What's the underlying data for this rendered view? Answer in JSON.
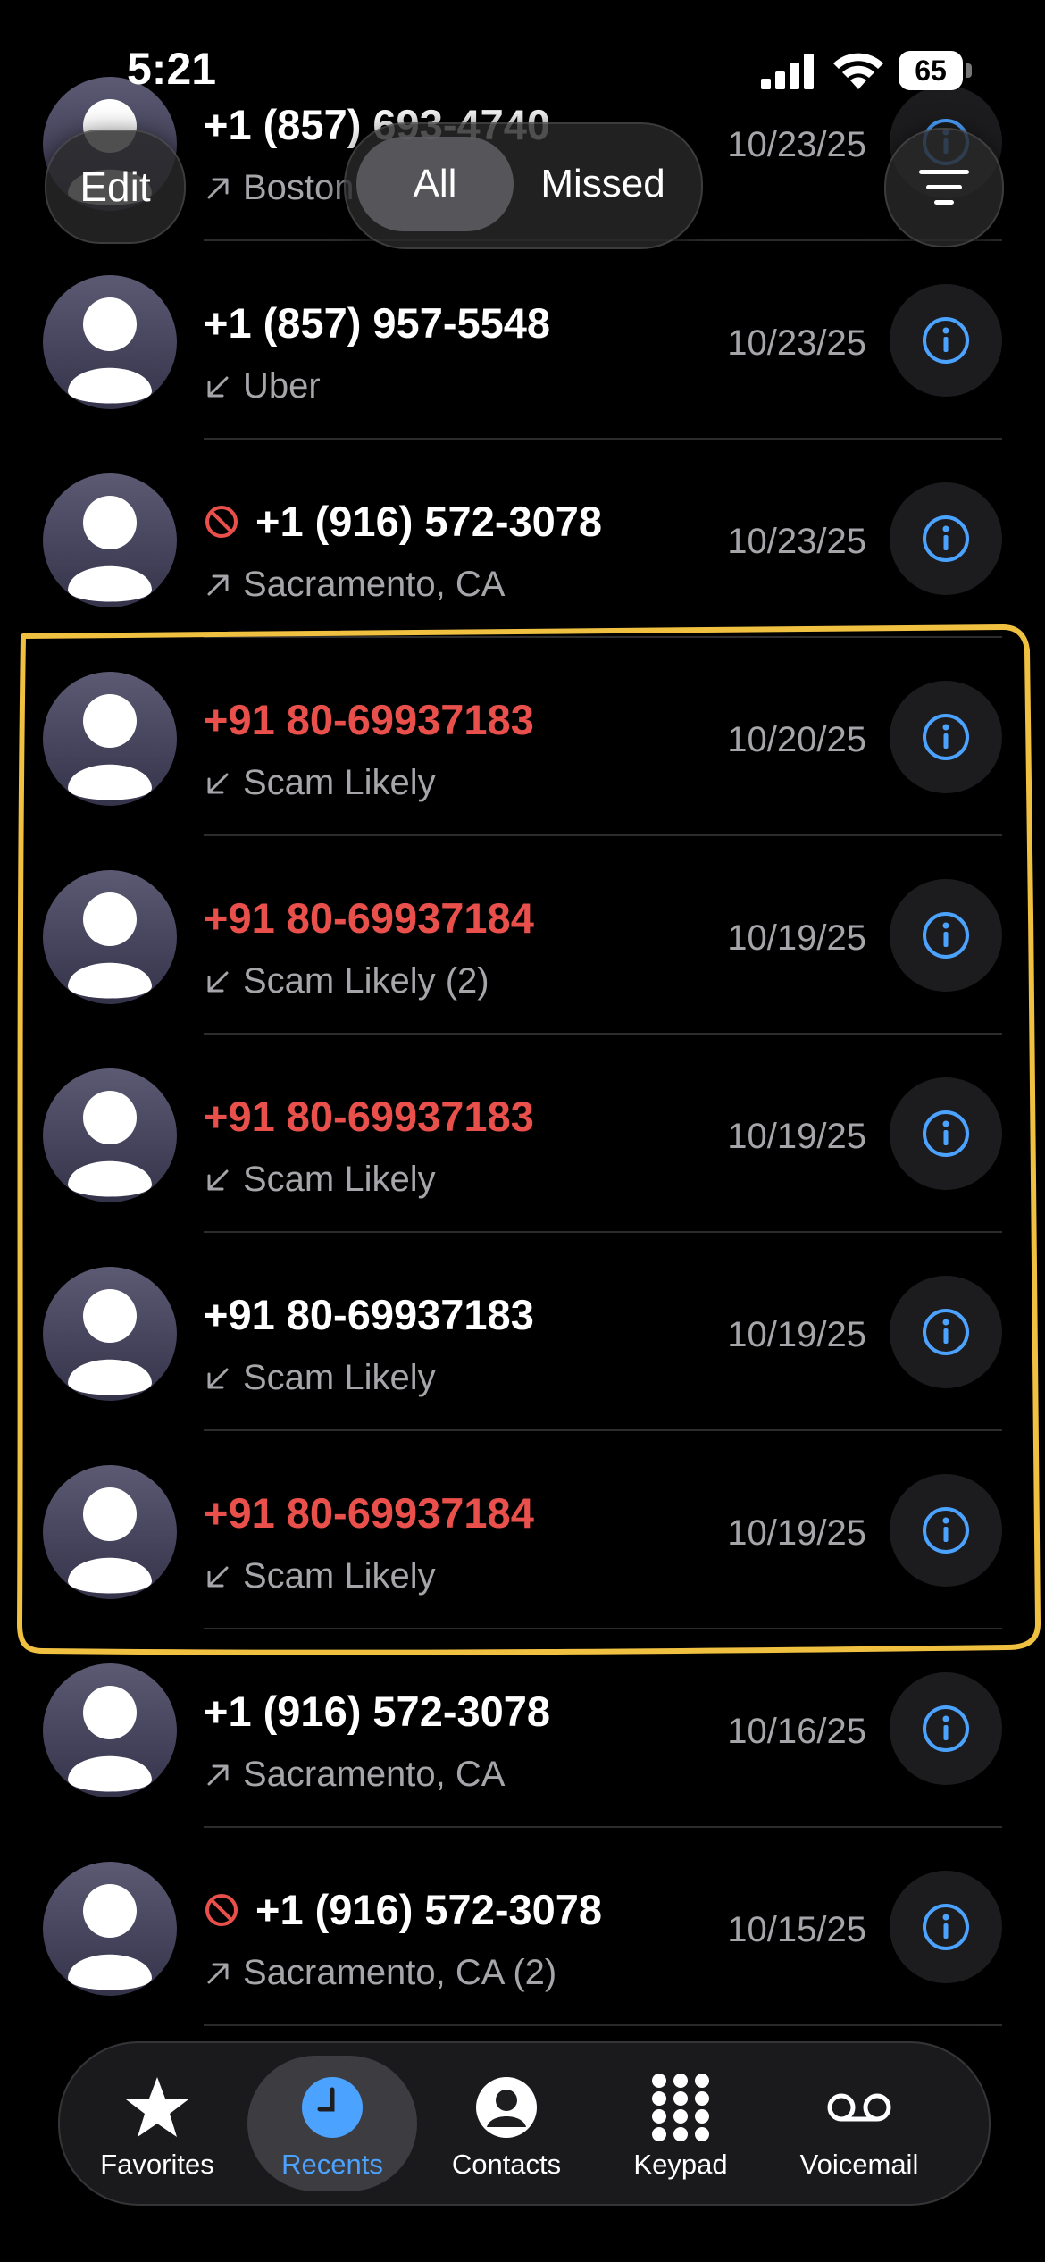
{
  "status_bar": {
    "time": "5:21",
    "battery": "65"
  },
  "header": {
    "edit_label": "Edit",
    "segment": {
      "all": "All",
      "missed": "Missed",
      "selected": "All"
    }
  },
  "calls": [
    {
      "number": "+1 (857) 693-4740",
      "subtitle": "Boston",
      "direction": "outgoing",
      "date": "10/23/25",
      "missed": false,
      "blocked": false
    },
    {
      "number": "+1 (857) 957-5548",
      "subtitle": "Uber",
      "direction": "incoming",
      "date": "10/23/25",
      "missed": false,
      "blocked": false
    },
    {
      "number": "+1 (916) 572-3078",
      "subtitle": "Sacramento, CA",
      "direction": "outgoing",
      "date": "10/23/25",
      "missed": false,
      "blocked": true
    },
    {
      "number": "+91 80-69937183",
      "subtitle": "Scam Likely",
      "direction": "incoming",
      "date": "10/20/25",
      "missed": true,
      "blocked": false
    },
    {
      "number": "+91 80-69937184",
      "subtitle": "Scam Likely (2)",
      "direction": "incoming",
      "date": "10/19/25",
      "missed": true,
      "blocked": false
    },
    {
      "number": "+91 80-69937183",
      "subtitle": "Scam Likely",
      "direction": "incoming",
      "date": "10/19/25",
      "missed": true,
      "blocked": false
    },
    {
      "number": "+91 80-69937183",
      "subtitle": "Scam Likely",
      "direction": "incoming",
      "date": "10/19/25",
      "missed": false,
      "blocked": false
    },
    {
      "number": "+91 80-69937184",
      "subtitle": "Scam Likely",
      "direction": "incoming",
      "date": "10/19/25",
      "missed": true,
      "blocked": false
    },
    {
      "number": "+1 (916) 572-3078",
      "subtitle": "Sacramento, CA",
      "direction": "outgoing",
      "date": "10/16/25",
      "missed": false,
      "blocked": false
    },
    {
      "number": "+1 (916) 572-3078",
      "subtitle": "Sacramento, CA (2)",
      "direction": "outgoing",
      "date": "10/15/25",
      "missed": false,
      "blocked": true
    }
  ],
  "tabs": [
    {
      "label": "Favorites",
      "icon": "star-icon",
      "active": false
    },
    {
      "label": "Recents",
      "icon": "clock-icon",
      "active": true
    },
    {
      "label": "Contacts",
      "icon": "person-circle-icon",
      "active": false
    },
    {
      "label": "Keypad",
      "icon": "keypad-icon",
      "active": false
    },
    {
      "label": "Voicemail",
      "icon": "voicemail-icon",
      "active": false
    }
  ],
  "colors": {
    "missed_red": "#e9504b",
    "accent_blue": "#4ba3ff",
    "annotation_yellow": "#f0c040",
    "background": "#000000"
  }
}
